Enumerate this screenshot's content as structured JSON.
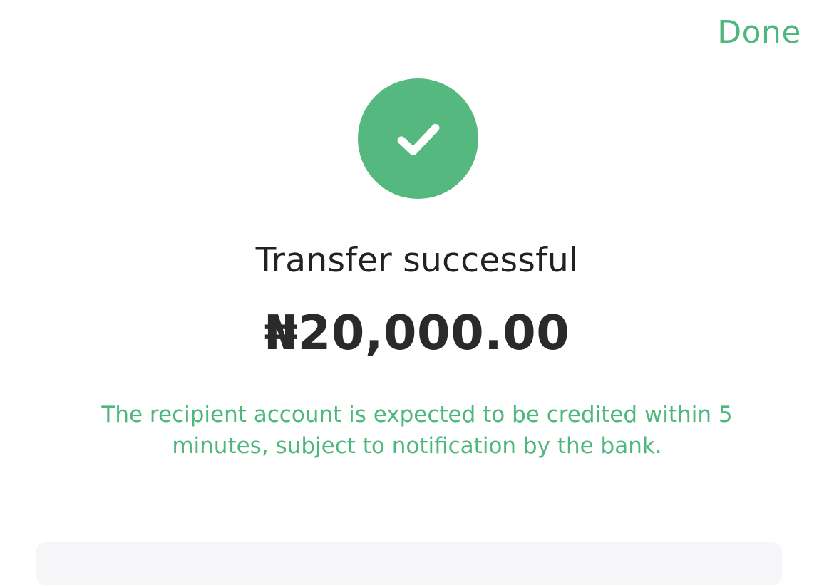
{
  "header": {
    "done_label": "Done"
  },
  "status": {
    "icon": "checkmark-circle-icon",
    "title": "Transfer successful",
    "amount": "₦20,000.00",
    "note": "The recipient account is expected to be credited within 5 minutes, subject to notification by the bank."
  },
  "colors": {
    "accent": "#4db77d",
    "success_circle": "#55b97f",
    "text_primary": "#222222",
    "card_background": "#f6f6f9"
  }
}
